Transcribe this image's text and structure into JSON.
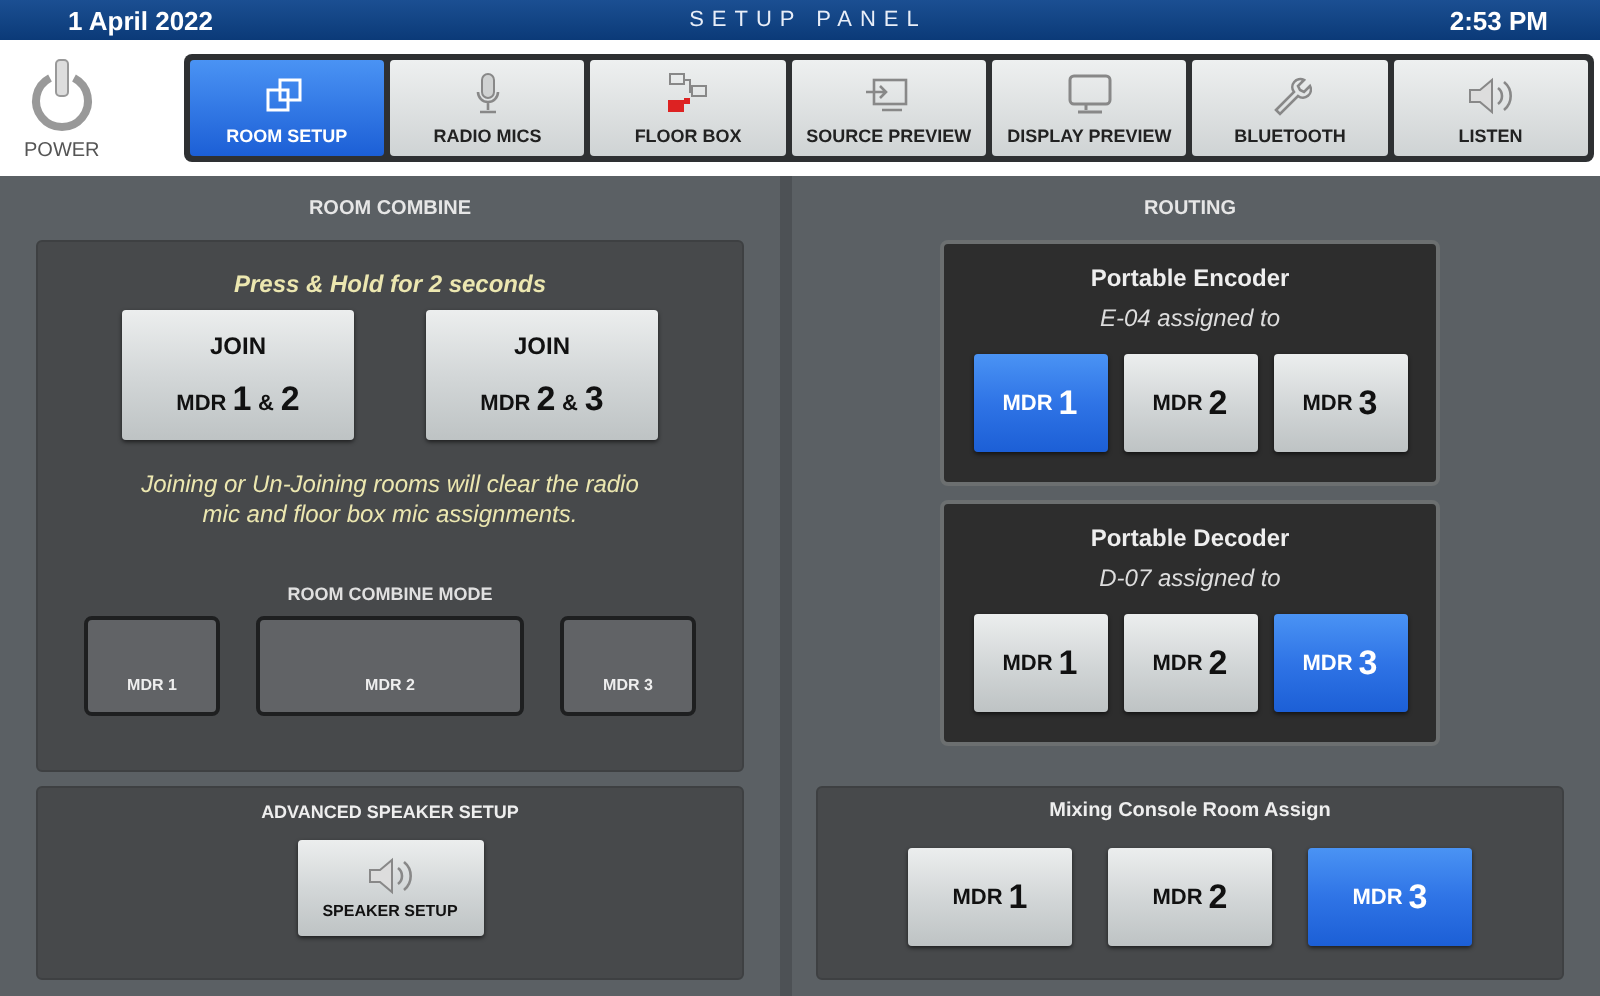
{
  "header": {
    "date": "1 April 2022",
    "title": "SETUP PANEL",
    "time": "2:53 PM"
  },
  "power": {
    "label": "POWER"
  },
  "tabs": [
    {
      "label": "ROOM SETUP",
      "selected": true
    },
    {
      "label": "RADIO MICS",
      "selected": false
    },
    {
      "label": "FLOOR BOX",
      "selected": false
    },
    {
      "label": "SOURCE PREVIEW",
      "selected": false
    },
    {
      "label": "DISPLAY PREVIEW",
      "selected": false
    },
    {
      "label": "BLUETOOTH",
      "selected": false
    },
    {
      "label": "LISTEN",
      "selected": false
    }
  ],
  "room_combine": {
    "title": "ROOM COMBINE",
    "hint": "Press & Hold for 2 seconds",
    "join_buttons": [
      {
        "title": "JOIN",
        "room": "MDR",
        "first": "1",
        "joiner": "&",
        "second": "2"
      },
      {
        "title": "JOIN",
        "room": "MDR",
        "first": "2",
        "joiner": "&",
        "second": "3"
      }
    ],
    "warning": "Joining or Un-Joining rooms will clear the radio mic and floor box mic assignments.",
    "mode_title": "ROOM COMBINE MODE",
    "modes": [
      {
        "label": "MDR 1",
        "selected": false
      },
      {
        "label": "MDR 2",
        "selected": false
      },
      {
        "label": "MDR 3",
        "selected": false
      }
    ]
  },
  "advanced_speaker": {
    "title": "ADVANCED SPEAKER SETUP",
    "button": "SPEAKER SETUP"
  },
  "routing": {
    "title": "ROUTING",
    "groups": [
      {
        "title": "Portable Encoder",
        "subtitle": "E-04 assigned to",
        "options": [
          {
            "prefix": "MDR",
            "number": "1",
            "selected": true
          },
          {
            "prefix": "MDR",
            "number": "2",
            "selected": false
          },
          {
            "prefix": "MDR",
            "number": "3",
            "selected": false
          }
        ]
      },
      {
        "title": "Portable Decoder",
        "subtitle": "D-07 assigned to",
        "options": [
          {
            "prefix": "MDR",
            "number": "1",
            "selected": false
          },
          {
            "prefix": "MDR",
            "number": "2",
            "selected": false
          },
          {
            "prefix": "MDR",
            "number": "3",
            "selected": true
          }
        ]
      }
    ]
  },
  "mixing_console": {
    "title": "Mixing Console Room Assign",
    "options": [
      {
        "prefix": "MDR",
        "number": "1",
        "selected": false
      },
      {
        "prefix": "MDR",
        "number": "2",
        "selected": false
      },
      {
        "prefix": "MDR",
        "number": "3",
        "selected": true
      }
    ]
  }
}
